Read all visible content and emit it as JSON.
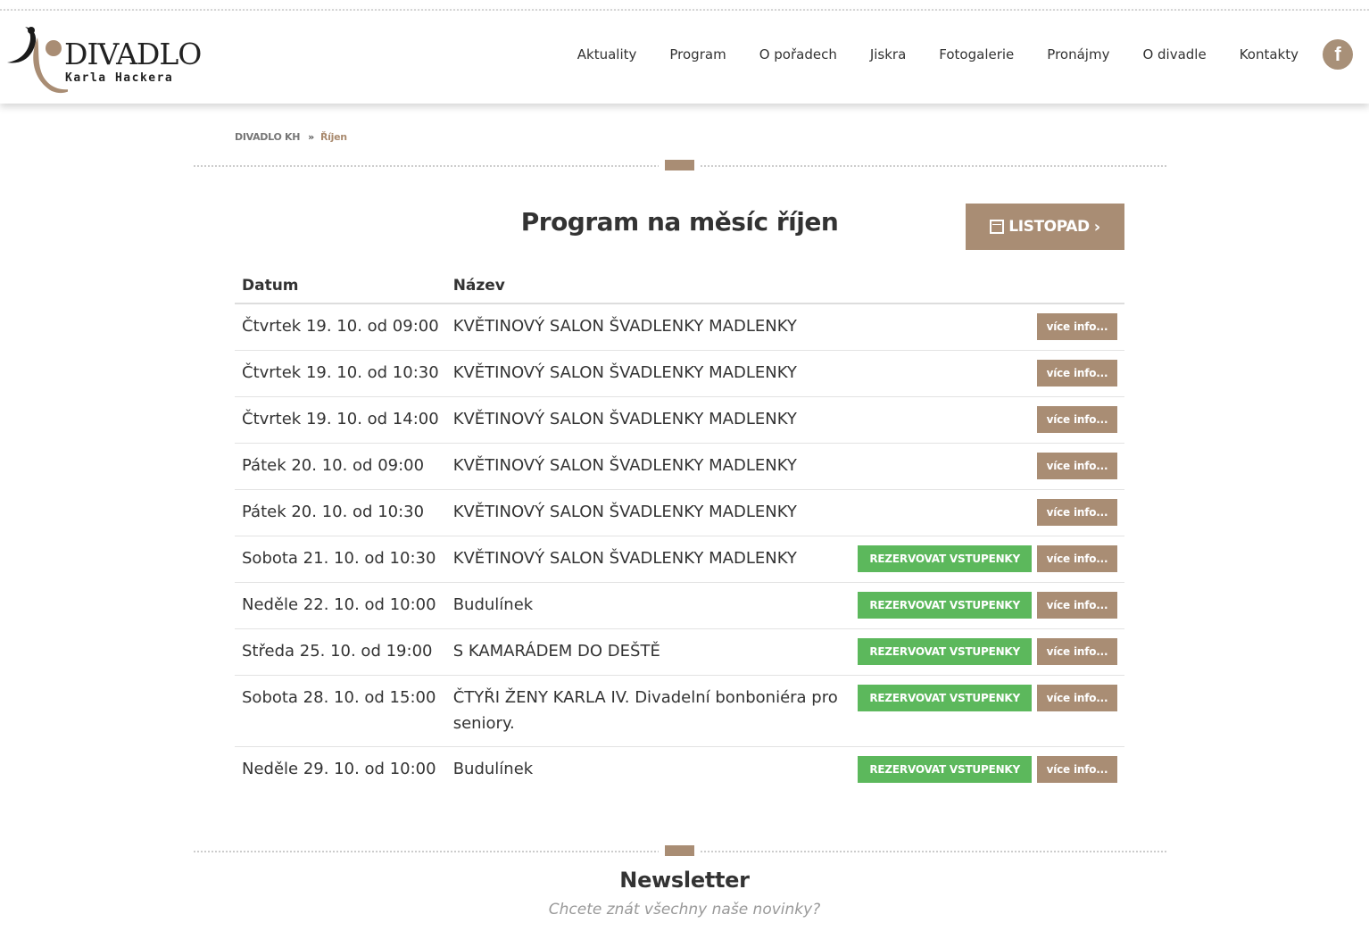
{
  "logo": {
    "line1": "DIVADLO",
    "line2": "Karla Hackera"
  },
  "nav": {
    "items": [
      "Aktuality",
      "Program",
      "O pořadech",
      "Jiskra",
      "Fotogalerie",
      "Pronájmy",
      "O divadle",
      "Kontakty"
    ],
    "facebook_glyph": "f"
  },
  "breadcrumb": {
    "home": "DIVADLO KH",
    "separator": "»",
    "current": "Říjen"
  },
  "main": {
    "title": "Program na měsíc říjen",
    "next_month_label": "LISTOPAD",
    "table": {
      "headers": [
        "Datum",
        "Název"
      ],
      "reserve_label": "REZERVOVAT VSTUPENKY",
      "info_label": "více info...",
      "rows": [
        {
          "date": "Čtvrtek 19. 10. od 09:00",
          "name": "KVĚTINOVÝ SALON ŠVADLENKY MADLENKY",
          "reserve": false
        },
        {
          "date": "Čtvrtek 19. 10. od 10:30",
          "name": "KVĚTINOVÝ SALON ŠVADLENKY MADLENKY",
          "reserve": false
        },
        {
          "date": "Čtvrtek 19. 10. od 14:00",
          "name": "KVĚTINOVÝ SALON ŠVADLENKY MADLENKY",
          "reserve": false
        },
        {
          "date": "Pátek 20. 10. od 09:00",
          "name": "KVĚTINOVÝ SALON ŠVADLENKY MADLENKY",
          "reserve": false
        },
        {
          "date": "Pátek 20. 10. od 10:30",
          "name": "KVĚTINOVÝ SALON ŠVADLENKY MADLENKY",
          "reserve": false
        },
        {
          "date": "Sobota 21. 10. od 10:30",
          "name": "KVĚTINOVÝ SALON ŠVADLENKY MADLENKY",
          "reserve": true
        },
        {
          "date": "Neděle 22. 10. od 10:00",
          "name": "Budulínek",
          "reserve": true
        },
        {
          "date": "Středa 25. 10. od 19:00",
          "name": "S KAMARÁDEM DO DEŠTĚ",
          "reserve": true
        },
        {
          "date": "Sobota 28. 10. od 15:00",
          "name": "ČTYŘI ŽENY KARLA IV. Divadelní bonboniéra pro seniory.",
          "reserve": true
        },
        {
          "date": "Neděle 29. 10. od 10:00",
          "name": "Budulínek",
          "reserve": true
        }
      ]
    }
  },
  "newsletter": {
    "title": "Newsletter",
    "subtitle": "Chcete znát všechny naše novinky?"
  },
  "colors": {
    "accent": "#a98d74",
    "reserve": "#5cb85c"
  }
}
